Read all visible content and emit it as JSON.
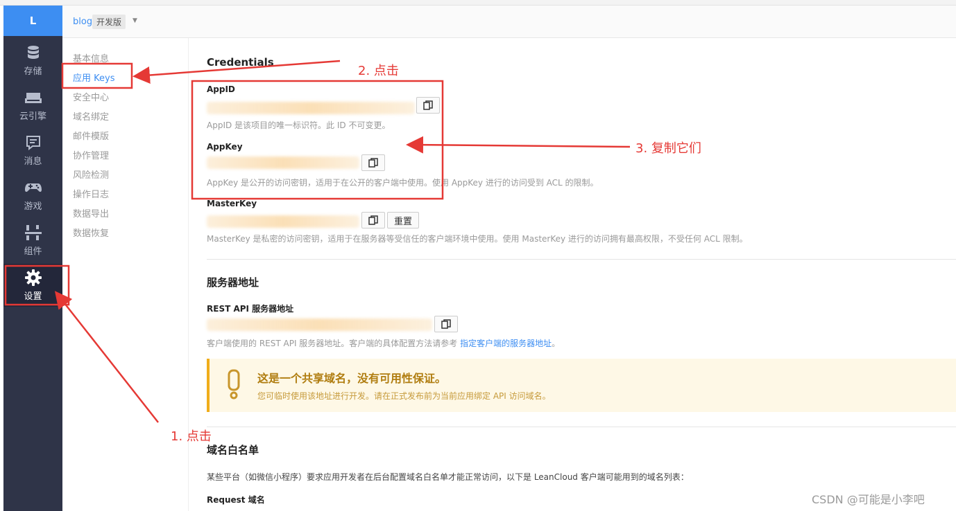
{
  "app": {
    "logo": "L",
    "name": "blog",
    "badge": "开发版"
  },
  "sidebar": {
    "items": [
      {
        "label": "存储",
        "icon": "database-icon"
      },
      {
        "label": "云引擎",
        "icon": "cloud-engine-icon"
      },
      {
        "label": "消息",
        "icon": "message-icon"
      },
      {
        "label": "游戏",
        "icon": "gamepad-icon"
      },
      {
        "label": "组件",
        "icon": "components-icon"
      },
      {
        "label": "设置",
        "icon": "gear-icon",
        "active": true
      }
    ]
  },
  "subnav": {
    "items": [
      {
        "label": "基本信息"
      },
      {
        "label": "应用 Keys",
        "active": true
      },
      {
        "label": "安全中心"
      },
      {
        "label": "域名绑定"
      },
      {
        "label": "邮件模版"
      },
      {
        "label": "协作管理"
      },
      {
        "label": "风险检测"
      },
      {
        "label": "操作日志"
      },
      {
        "label": "数据导出"
      },
      {
        "label": "数据恢复"
      }
    ]
  },
  "credentials": {
    "title": "Credentials",
    "appid": {
      "label": "AppID",
      "desc": "AppID 是该项目的唯一标识符。此 ID 不可变更。"
    },
    "appkey": {
      "label": "AppKey",
      "desc": "AppKey 是公开的访问密钥，适用于在公开的客户端中使用。使用 AppKey 进行的访问受到 ACL 的限制。"
    },
    "masterkey": {
      "label": "MasterKey",
      "reset": "重置",
      "desc": "MasterKey 是私密的访问密钥，适用于在服务器等受信任的客户端环境中使用。使用 MasterKey 进行的访问拥有最高权限，不受任何 ACL 限制。"
    }
  },
  "server": {
    "title": "服务器地址",
    "rest_label": "REST API 服务器地址",
    "desc_prefix": "客户端使用的 REST API 服务器地址。客户端的具体配置方法请参考 ",
    "desc_link": "指定客户端的服务器地址",
    "desc_suffix": "。",
    "warning_title": "这是一个共享域名，没有可用性保证。",
    "warning_text": "您可临时使用该地址进行开发。请在正式发布前为当前应用绑定 API 访问域名。"
  },
  "whitelist": {
    "title": "域名白名单",
    "desc": "某些平台（如微信小程序）要求应用开发者在后台配置域名白名单才能正常访问，以下是 LeanCloud 客户端可能用到的域名列表：",
    "request_label": "Request 域名"
  },
  "annotations": {
    "step1": "1. 点击",
    "step2": "2. 点击",
    "step3": "3. 复制它们"
  },
  "watermark": "CSDN @可能是小李吧",
  "colors": {
    "sidebar_bg": "#2f3448",
    "accent": "#3d8ef2",
    "annotation": "#e53935",
    "warning_border": "#f0ad1a"
  }
}
